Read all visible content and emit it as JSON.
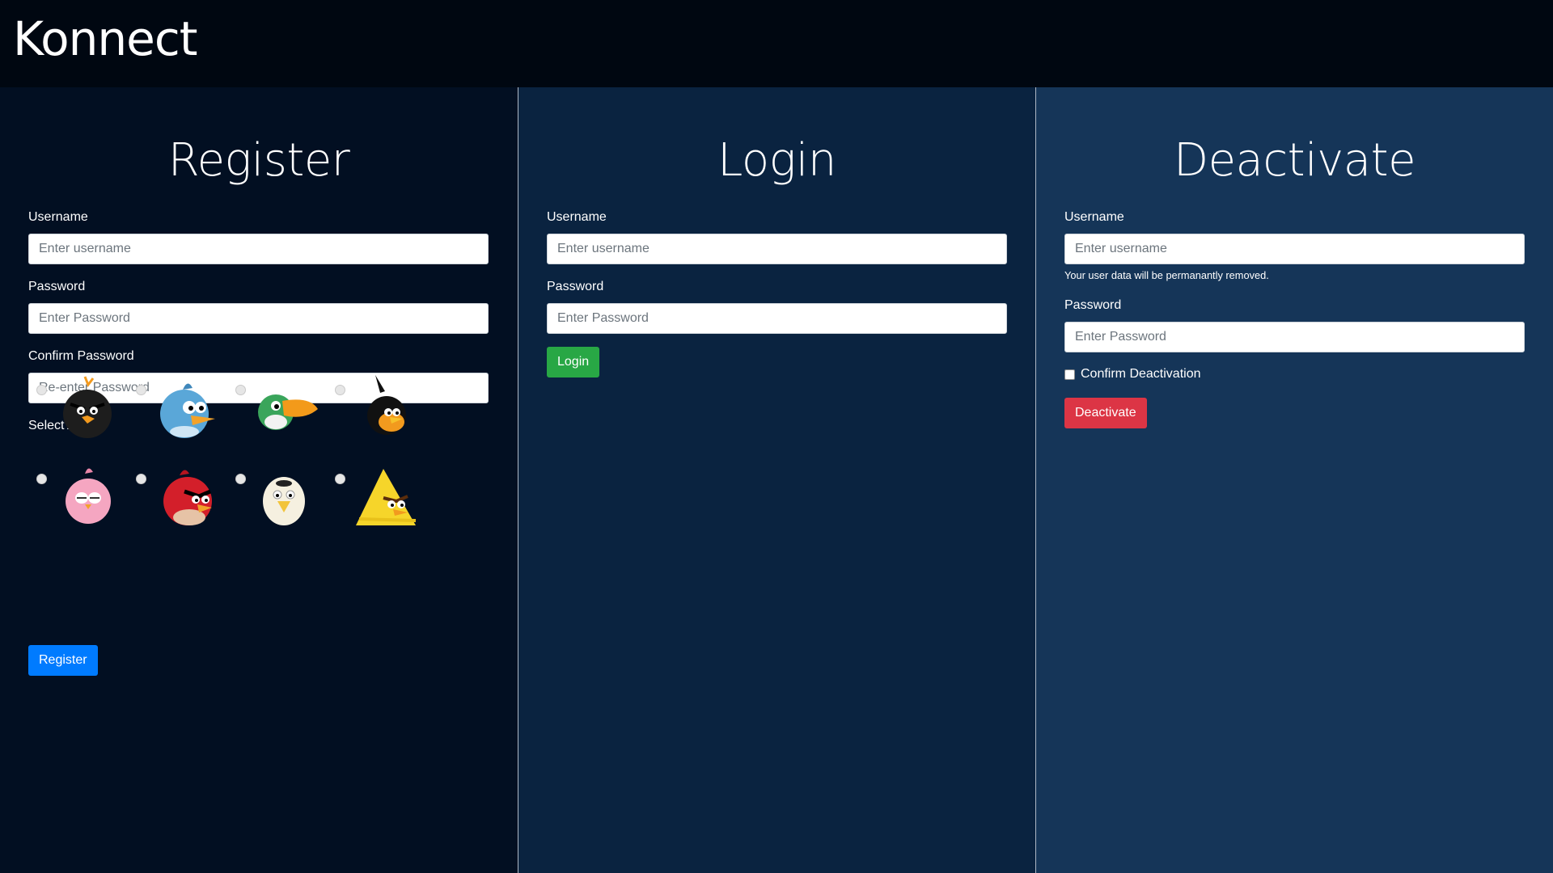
{
  "app": {
    "brand": "Konnect"
  },
  "register": {
    "title": "Register",
    "username_label": "Username",
    "username_placeholder": "Enter username",
    "password_label": "Password",
    "password_placeholder": "Enter Password",
    "confirm_label": "Confirm Password",
    "confirm_placeholder": "Re-enter Password",
    "avatar_label": "Select Avatar",
    "avatars": [
      {
        "name": "black-bird",
        "color": "#1d1d1d"
      },
      {
        "name": "blue-bird",
        "color": "#5aa7d8"
      },
      {
        "name": "green-toucan-bird",
        "color": "#3aa55b"
      },
      {
        "name": "orange-black-bird",
        "color": "#f29a1e"
      },
      {
        "name": "pink-bird",
        "color": "#f5a6c1"
      },
      {
        "name": "red-bird",
        "color": "#d31f2a"
      },
      {
        "name": "white-bird",
        "color": "#f5f0e0"
      },
      {
        "name": "yellow-bird",
        "color": "#f6d52a"
      }
    ],
    "button_label": "Register"
  },
  "login": {
    "title": "Login",
    "username_label": "Username",
    "username_placeholder": "Enter username",
    "password_label": "Password",
    "password_placeholder": "Enter Password",
    "button_label": "Login"
  },
  "deactivate": {
    "title": "Deactivate",
    "username_label": "Username",
    "username_placeholder": "Enter username",
    "help_text": "Your user data will be permanantly removed.",
    "password_label": "Password",
    "password_placeholder": "Enter Password",
    "confirm_label": "Confirm Deactivation",
    "button_label": "Deactivate"
  },
  "colors": {
    "primary": "#007bff",
    "success": "#28a745",
    "danger": "#dc3545"
  }
}
